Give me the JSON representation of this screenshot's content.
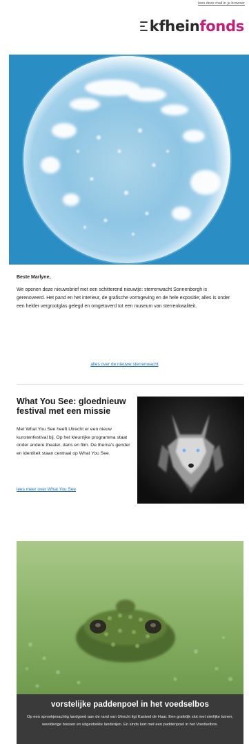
{
  "header": {
    "top_link": "lees deze mail in je browser",
    "logo_prefix": "kfhein",
    "logo_suffix": "fonds"
  },
  "hero": {
    "image_icon": "sun-image"
  },
  "letter": {
    "greeting": "Beste Marlyne,",
    "body": "We openen deze nieuwsbrief met een schitterend nieuwtje: sterrenwacht Sonnenborgh is gerenoveerd. Het pand en het interieur, de grafische vormgeving en de hele expositie; alles is onder een helder vergrootglas gelegd en omgetoverd tot een museum van sterrenkwaliteit.",
    "link": "alles over de nieuwe sterrenwacht"
  },
  "article": {
    "title": "What You See: gloednieuw festival met een missie",
    "body": "Met What You See heeft Utrecht er een nieuw kunstenfestival bij. Op het kleurrijke programma staat onder andere theater, dans en film. De thema's gender en identiteit staan centraal op What You See.",
    "link": "lees meer over What You See",
    "image_icon": "wolf-image"
  },
  "feature": {
    "image_icon": "frog-image",
    "title": "vorstelijke paddenpoel in het voedselbos",
    "body": "Op een sprookjesachtig landgoed aan de rand van Utrecht ligt Kasteel de Haar. Een grafelijk slot met sierlijke tuinen, weelderige bossen en uitgestrekte landerijen. En sinds kort met een paddenpoel in het Voedselbos."
  },
  "colors": {
    "brand": "#c41e7a",
    "link": "#1a74c9",
    "hero_bg": "#2a8ec4",
    "caption_bg": "#3a3a3a"
  }
}
